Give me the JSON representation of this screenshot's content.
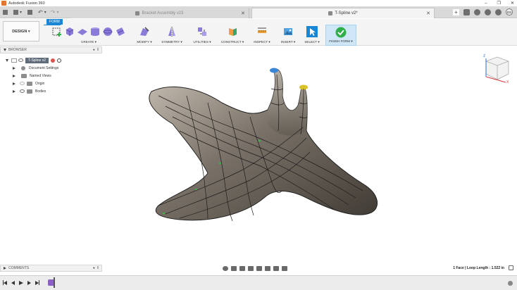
{
  "app": {
    "title": "Autodesk Fusion 360"
  },
  "tabs": [
    {
      "label": "Bracket Assembly v23",
      "active": false
    },
    {
      "label": "T-Spline v2*",
      "active": true
    }
  ],
  "user": {
    "initials": "DS"
  },
  "workspace": {
    "label": "DESIGN ▾"
  },
  "toolbar": {
    "active_tab": "FORM",
    "groups": [
      {
        "label": "CREATE ▾"
      },
      {
        "label": "MODIFY ▾"
      },
      {
        "label": "SYMMETRY ▾"
      },
      {
        "label": "UTILITIES ▾"
      },
      {
        "label": "CONSTRUCT ▾"
      },
      {
        "label": "INSPECT ▾"
      },
      {
        "label": "INSERT ▾"
      },
      {
        "label": "SELECT ▾"
      },
      {
        "label": "FINISH FORM ▾"
      }
    ]
  },
  "browser": {
    "title": "BROWSER",
    "root": "T-Spline v2",
    "items": [
      "Document Settings",
      "Named Views",
      "Origin",
      "Bodies"
    ]
  },
  "comments": {
    "title": "COMMENTS"
  },
  "status": {
    "text": "1 Face | Loop Length : 1.522 in"
  },
  "colors": {
    "accent": "#1a86d6",
    "finish": "#2fae49",
    "timeline_marker": "#8b5fc6"
  }
}
